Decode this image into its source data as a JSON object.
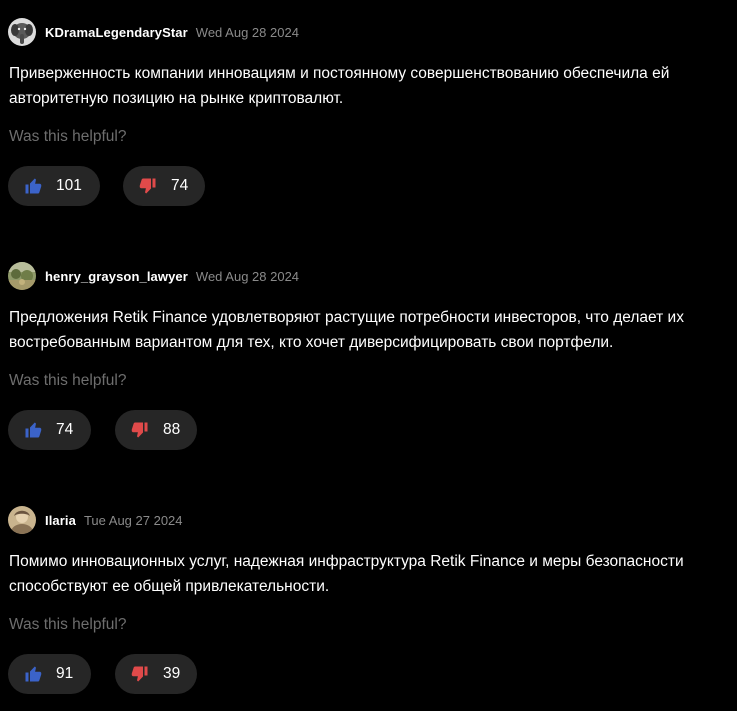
{
  "colors": {
    "background": "#000000",
    "text": "#ffffff",
    "muted": "#8a8a8a",
    "button_bg": "#262626",
    "upvote": "#3b63c9",
    "downvote": "#e04a4a"
  },
  "reviews": [
    {
      "username": "KDramaLegendaryStar",
      "date": "Wed Aug 28 2024",
      "text": "Приверженность компании инновациям и постоянному совершенствованию обеспечила ей авторитетную позицию на рынке криптовалют.",
      "helpful_prompt": "Was this helpful?",
      "upvotes": "101",
      "downvotes": "74",
      "avatar_icon": "elephant-avatar-icon"
    },
    {
      "username": "henry_grayson_lawyer",
      "date": "Wed Aug 28 2024",
      "text": "Предложения Retik Finance удовлетворяют растущие потребности инвесторов, что делает их востребованным вариантом для тех, кто хочет диверсифицировать свои портфели.",
      "helpful_prompt": "Was this helpful?",
      "upvotes": "74",
      "downvotes": "88",
      "avatar_icon": "landscape-avatar-icon"
    },
    {
      "username": "Ilaria",
      "date": "Tue Aug 27 2024",
      "text": "Помимо инновационных услуг, надежная инфраструктура Retik Finance и меры безопасности способствуют ее общей привлекательности.",
      "helpful_prompt": "Was this helpful?",
      "upvotes": "91",
      "downvotes": "39",
      "avatar_icon": "photo-avatar-icon"
    }
  ]
}
